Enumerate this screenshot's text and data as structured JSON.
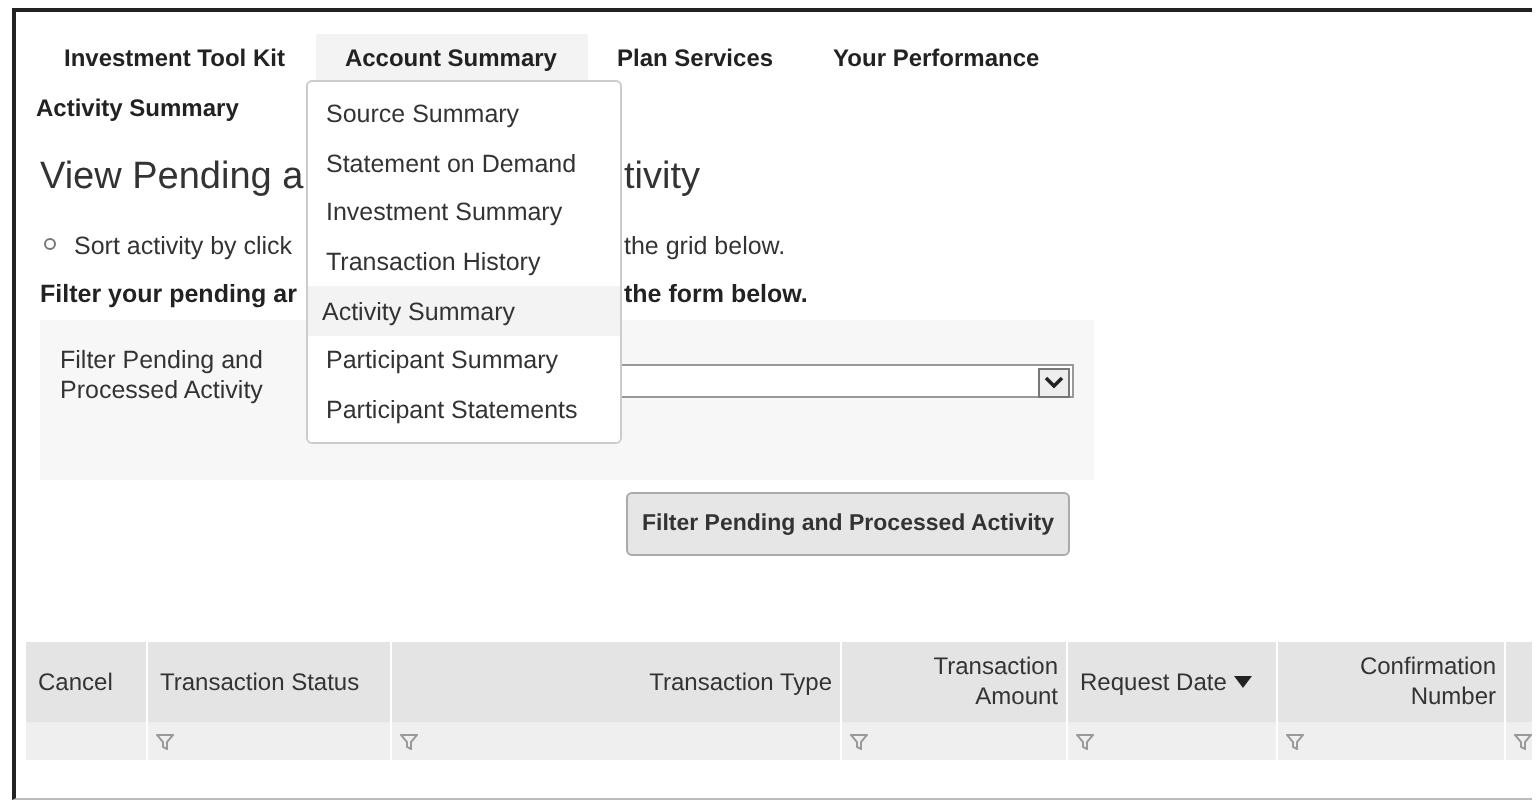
{
  "nav": {
    "tabs": [
      {
        "label": "Investment Tool Kit",
        "selected": false
      },
      {
        "label": "Account Summary",
        "selected": true
      },
      {
        "label": "Plan Services",
        "selected": false
      },
      {
        "label": "Your Performance",
        "selected": false
      }
    ],
    "breadcrumb": "Activity Summary"
  },
  "menu": {
    "items": [
      {
        "label": "Source Summary",
        "selected": false
      },
      {
        "label": "Statement on Demand",
        "selected": false
      },
      {
        "label": "Investment Summary",
        "selected": false
      },
      {
        "label": "Transaction History",
        "selected": false
      },
      {
        "label": "Activity Summary",
        "selected": true
      },
      {
        "label": "Participant Summary",
        "selected": false
      },
      {
        "label": "Participant Statements",
        "selected": false
      }
    ]
  },
  "title": {
    "left": "View Pending a",
    "right": "tivity"
  },
  "instruction": {
    "left": "Sort activity by click",
    "right": "the grid below."
  },
  "filter_heading": {
    "left": "Filter your pending ar",
    "right": "the form below."
  },
  "filter": {
    "label": "Filter Pending and Processed Activity",
    "button": "Filter Pending and Processed Activity"
  },
  "table": {
    "columns": [
      {
        "label": "Cancel",
        "sorted": false,
        "filter": false
      },
      {
        "label": "Transaction Status",
        "sorted": false,
        "filter": true
      },
      {
        "label": "Transaction Type",
        "sorted": false,
        "filter": true
      },
      {
        "label": "Transaction Amount",
        "sorted": false,
        "filter": true
      },
      {
        "label": "Request Date",
        "sorted": true,
        "filter": true
      },
      {
        "label": "Confirmation Number",
        "sorted": false,
        "filter": true
      },
      {
        "sorted": false,
        "filter": true
      }
    ]
  }
}
